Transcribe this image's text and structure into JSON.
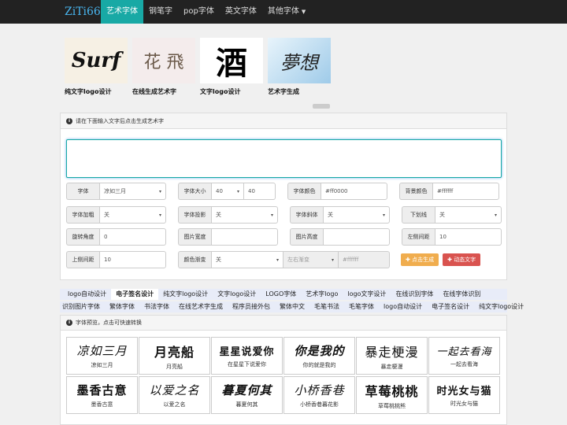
{
  "nav": {
    "logo": "ZiTi66",
    "items": [
      {
        "label": "艺术字体",
        "active": true
      },
      {
        "label": "钢笔字"
      },
      {
        "label": "pop字体"
      },
      {
        "label": "英文字体"
      },
      {
        "label": "其他字体",
        "dropdown": true
      }
    ]
  },
  "banners": [
    {
      "art": "Surf",
      "caption": "纯文字logo设计"
    },
    {
      "art": "花 飛",
      "caption": "在线生成艺术字"
    },
    {
      "art": "酒",
      "caption": "文字logo设计"
    },
    {
      "art": "夢想",
      "caption": "艺术字生成"
    }
  ],
  "panel": {
    "instruction": "请在下面输入文字后点击生成艺术字",
    "text_value": ""
  },
  "form": {
    "font_label": "字体",
    "font_value": "凉如三月",
    "size_label": "字体大小",
    "size_select": "40",
    "size_input": "40",
    "color_label": "字体颜色",
    "color_value": "#ff0000",
    "bg_label": "背景颜色",
    "bg_value": "#ffffff",
    "bold_label": "字体加粗",
    "bold_value": "关",
    "shadow_label": "字体投影",
    "shadow_value": "关",
    "italic_label": "字体斜体",
    "italic_value": "关",
    "underline_label": "下划线",
    "underline_value": "关",
    "rotate_label": "旋转角度",
    "rotate_value": "0",
    "width_label": "图片宽度",
    "width_value": "",
    "height_label": "图片高度",
    "height_value": "",
    "left_label": "左侧间距",
    "left_value": "10",
    "top_label": "上侧间距",
    "top_value": "10",
    "gradient_label": "颜色渐变",
    "gradient_value": "关",
    "gradient_dir": "左右渐变",
    "gradient_color": "#ffffff",
    "generate_btn": "点击生成",
    "animate_btn": "动态文字"
  },
  "tags_row1": [
    {
      "label": "logo自动设计"
    },
    {
      "label": "电子签名设计",
      "selected": true
    },
    {
      "label": "纯文字logo设计"
    },
    {
      "label": "文字logo设计"
    },
    {
      "label": "LOGO字体"
    },
    {
      "label": "艺术字logo"
    },
    {
      "label": "logo文字设计"
    },
    {
      "label": "在线识别字体"
    },
    {
      "label": "在线字体识别"
    }
  ],
  "tags_row2": [
    {
      "label": "识别图片字体"
    },
    {
      "label": "繁体字体"
    },
    {
      "label": "书法字体"
    },
    {
      "label": "在线艺术字生成"
    },
    {
      "label": "程序员接外包"
    },
    {
      "label": "繁体中文"
    },
    {
      "label": "毛笔书法"
    },
    {
      "label": "毛笔字体"
    },
    {
      "label": "logo自动设计"
    },
    {
      "label": "电子签名设计"
    },
    {
      "label": "纯文字logo设计"
    }
  ],
  "preview": {
    "title": "字体预览，点击可快速转换",
    "fonts": [
      {
        "art": "凉如三月",
        "name": "凉如三月"
      },
      {
        "art": "月亮船",
        "name": "月亮船"
      },
      {
        "art": "星星说爱你",
        "name": "在星星下说爱你"
      },
      {
        "art": "你是我的",
        "name": "你的就是我的"
      },
      {
        "art": "暴走梗漫",
        "name": "暴走梗漫"
      },
      {
        "art": "一起去看海",
        "name": "一起去看海"
      },
      {
        "art": "墨香古意",
        "name": "墨香古意"
      },
      {
        "art": "以爱之名",
        "name": "以爱之名"
      },
      {
        "art": "暮夏何其",
        "name": "暮夏何其"
      },
      {
        "art": "小桥香巷",
        "name": "小桥香巷暮花影"
      },
      {
        "art": "草莓桃桃",
        "name": "草莓桃桃熊"
      },
      {
        "art": "时光女与猫",
        "name": "时光女与猫"
      }
    ]
  }
}
